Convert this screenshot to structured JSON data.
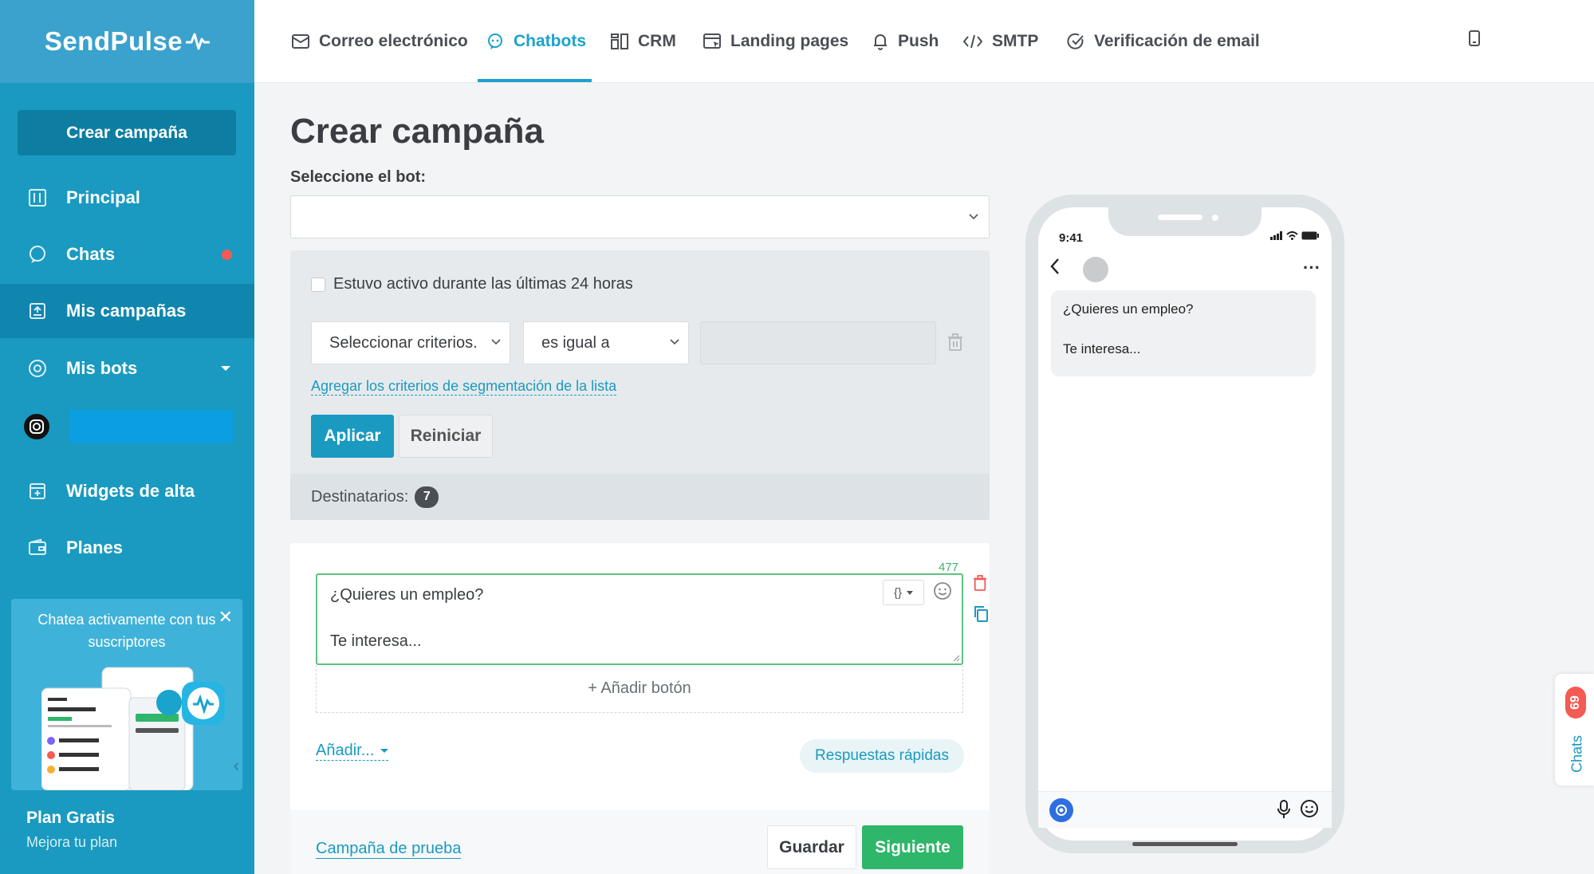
{
  "brand": {
    "name": "SendPulse"
  },
  "sidebar": {
    "create_button": "Crear campaña",
    "items": [
      {
        "label": "Principal",
        "icon": "dashboard-icon"
      },
      {
        "label": "Chats",
        "icon": "chat-bubble-icon"
      },
      {
        "label": "Mis campañas",
        "icon": "campaign-icon"
      },
      {
        "label": "Mis bots",
        "icon": "bot-icon"
      },
      {
        "label": "Widgets de alta",
        "icon": "widget-icon"
      },
      {
        "label": "Planes",
        "icon": "wallet-icon"
      }
    ],
    "promo_text": "Chatea activamente con tus suscriptores",
    "plan_title": "Plan Gratis",
    "plan_sub": "Mejora tu plan"
  },
  "topnav": {
    "tabs": [
      {
        "label": "Correo electrónico",
        "icon": "mail-icon"
      },
      {
        "label": "Chatbots",
        "icon": "chatbot-icon"
      },
      {
        "label": "CRM",
        "icon": "crm-icon"
      },
      {
        "label": "Landing pages",
        "icon": "landing-icon"
      },
      {
        "label": "Push",
        "icon": "bell-icon"
      },
      {
        "label": "SMTP",
        "icon": "code-icon"
      },
      {
        "label": "Verificación de email",
        "icon": "check-circle-icon"
      }
    ],
    "active_tab": "Chatbots"
  },
  "main": {
    "title": "Crear campaña",
    "bot_label": "Seleccione el bot:",
    "bot_select_value": "",
    "filter": {
      "active_24h_label": "Estuvo activo durante las últimas 24 horas",
      "criteria_placeholder": "Seleccionar criterios.",
      "operator_value": "es igual a",
      "value": "",
      "add_segment_link": "Agregar los criterios de segmentación de la lista",
      "apply_button": "Aplicar",
      "reset_button": "Reiniciar",
      "recipients_label": "Destinatarios:",
      "recipients_count": "7"
    },
    "message": {
      "char_counter": "477",
      "line1": "¿Quieres un empleo?",
      "line2": "Te interesa...",
      "add_button": "+ Añadir botón",
      "add_more": "Añadir...",
      "quick_replies": "Respuestas rápidas"
    },
    "footer": {
      "test_campaign": "Campaña de prueba",
      "save": "Guardar",
      "next": "Siguiente"
    }
  },
  "preview": {
    "time": "9:41",
    "bubble_line1": "¿Quieres un empleo?",
    "bubble_line2": "Te interesa..."
  },
  "chats_widget": {
    "label": "Chats",
    "count": "69"
  },
  "colors": {
    "sidebar": "#1a9ac0",
    "accent": "#1aa3cd",
    "primary_green": "#2eb66a",
    "alert_red": "#f35b54"
  }
}
